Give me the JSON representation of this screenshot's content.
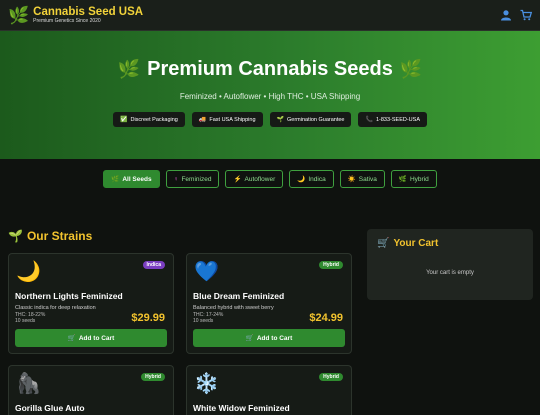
{
  "header": {
    "logo_icon": "leaf-icon",
    "title": "Cannabis Seed USA",
    "tagline": "Premium Genetics Since 2020",
    "icons": [
      "user-icon",
      "cart-icon"
    ]
  },
  "hero": {
    "title": "Premium Cannabis Seeds",
    "subtitle": "Feminized • Autoflower • High THC • USA Shipping",
    "badges": [
      {
        "icon": "✅",
        "label": "Discreet Packaging"
      },
      {
        "icon": "🚚",
        "label": "Fast USA Shipping"
      },
      {
        "icon": "🌱",
        "label": "Germination Guarantee"
      },
      {
        "icon": "📞",
        "label": "1-833-SEED-USA"
      }
    ]
  },
  "filters": [
    {
      "icon": "🌿",
      "label": "All Seeds"
    },
    {
      "icon": "♀",
      "label": "Feminized"
    },
    {
      "icon": "⚡",
      "label": "Autoflower"
    },
    {
      "icon": "🌙",
      "label": "Indica"
    },
    {
      "icon": "☀️",
      "label": "Sativa"
    },
    {
      "icon": "🌿",
      "label": "Hybrid"
    }
  ],
  "strains": {
    "title": "Our Strains",
    "add_label": "Add to Cart",
    "products": [
      {
        "emoji": "🌙",
        "badge": "Indica",
        "name": "Northern Lights Feminized",
        "desc": "Classic indica for deep relaxation",
        "thc": "THC: 18-22%",
        "count": "10 seeds",
        "price": "$29.99"
      },
      {
        "emoji": "💙",
        "badge": "Hybrid",
        "name": "Blue Dream Feminized",
        "desc": "Balanced hybrid with sweet berry",
        "thc": "THC: 17-24%",
        "count": "10 seeds",
        "price": "$24.99"
      },
      {
        "emoji": "🦍",
        "badge": "Hybrid",
        "name": "Gorilla Glue Auto",
        "desc": "",
        "thc": "",
        "count": "",
        "price": ""
      },
      {
        "emoji": "❄️",
        "badge": "Hybrid",
        "name": "White Widow Feminized",
        "desc": "",
        "thc": "",
        "count": "",
        "price": ""
      }
    ]
  },
  "cart": {
    "title": "Your Cart",
    "empty_text": "Your cart is empty"
  },
  "colors": {
    "accent_yellow": "#f2c32e",
    "brand_green": "#2f8a2f",
    "indica_purple": "#7a3ec0"
  }
}
